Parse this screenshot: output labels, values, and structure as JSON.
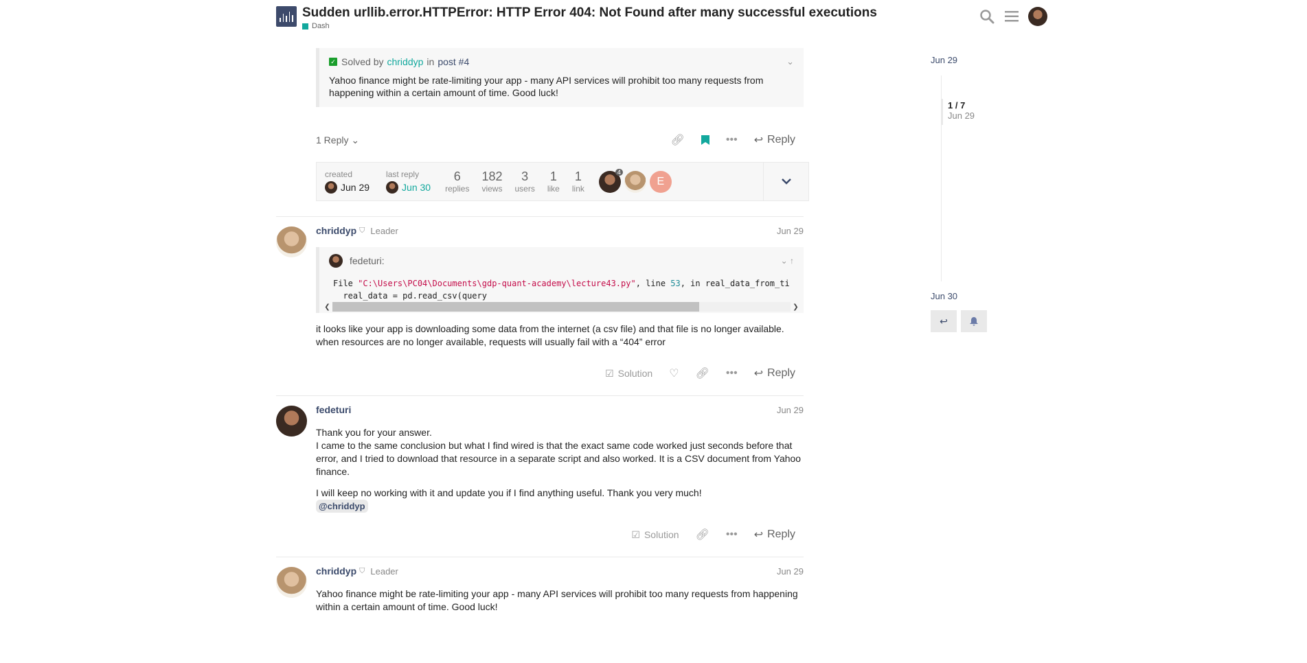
{
  "header": {
    "title": "Sudden urllib.error.HTTPError: HTTP Error 404: Not Found after many successful executions",
    "category": "Dash",
    "category_color": "#12a89d"
  },
  "first_post": {
    "solved_label": "Solved by",
    "solved_user": "chriddyp",
    "solved_in": "in",
    "solved_post": "post #4",
    "solution_text": "Yahoo finance might be rate-limiting your app - many API services will prohibit too many requests from happening within a certain amount of time. Good luck!",
    "replies_label": "1 Reply",
    "reply_label": "Reply"
  },
  "topic_map": {
    "created_label": "created",
    "created_date": "Jun 29",
    "last_reply_label": "last reply",
    "last_reply_date": "Jun 30",
    "stats": [
      {
        "n": "6",
        "l": "replies"
      },
      {
        "n": "182",
        "l": "views"
      },
      {
        "n": "3",
        "l": "users"
      },
      {
        "n": "1",
        "l": "like"
      },
      {
        "n": "1",
        "l": "link"
      }
    ],
    "avatar_badge": "4",
    "avatar_letter": "E"
  },
  "post2": {
    "username": "chriddyp",
    "flair": "Leader",
    "date": "Jun 29",
    "quote_user": "fedeturi:",
    "code_line1_pre": "File ",
    "code_line1_str": "\"C:\\Users\\PC04\\Documents\\gdp-quant-academy\\lecture43.py\"",
    "code_line1_mid": ", line ",
    "code_line1_num": "53",
    "code_line1_post": ", in real_data_from_ti",
    "code_line2": "  real_data = pd.read_csv(query",
    "text": "it looks like your app is downloading some data from the internet (a csv file) and that file is no longer available. when resources are no longer available, requests will usually fail with a “404” error",
    "solution_label": "Solution",
    "reply_label": "Reply"
  },
  "post3": {
    "username": "fedeturi",
    "date": "Jun 29",
    "text1": "Thank you for your answer.",
    "text2": "I came to the same conclusion but what I find wired is that the exact same code worked just seconds before that error, and I tried to download that resource in a separate script and also worked. It is a CSV document from Yahoo finance.",
    "text3": "I will keep no working with it and update you if I find anything useful. Thank you very much!",
    "mention": "@chriddyp",
    "solution_label": "Solution",
    "reply_label": "Reply"
  },
  "post4": {
    "username": "chriddyp",
    "flair": "Leader",
    "date": "Jun 29",
    "text": "Yahoo finance might be rate-limiting your app - many API services will prohibit too many requests from happening within a certain amount of time. Good luck!"
  },
  "timeline": {
    "top_date": "Jun 29",
    "position": "1 / 7",
    "position_date": "Jun 29",
    "bottom_date": "Jun 30"
  }
}
